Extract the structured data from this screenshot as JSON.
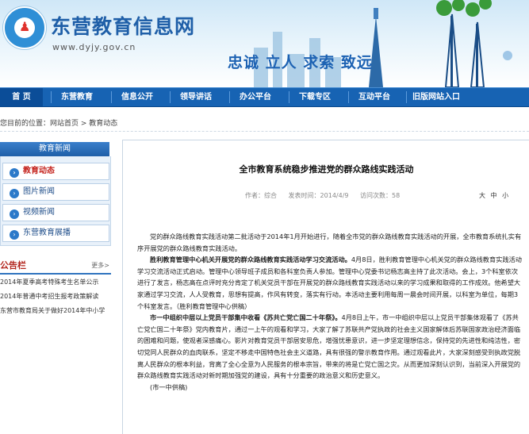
{
  "header": {
    "site_title": "东营教育信息网",
    "site_url": "www.dyjy.gov.cn",
    "slogan": "忠诚  立人  求索  致远",
    "logo_text": "DONGYING EDUCATION",
    "logo_top_text": "东营教育"
  },
  "nav": {
    "items": [
      "首 页",
      "东营教育",
      "信息公开",
      "领导讲话",
      "办公平台",
      "下载专区",
      "互动平台",
      "旧版网站入口"
    ]
  },
  "breadcrumb": "您目前的位置：网站首页  >  教育动态",
  "sidebar": {
    "title": "教育新闻",
    "items": [
      "教育动态",
      "图片新闻",
      "视频新闻",
      "东营教育展播"
    ]
  },
  "notice": {
    "title": "公告栏",
    "more": "更多>",
    "items": [
      "2014年夏季高考特殊考生名单公示",
      "2014年普通中考招生报考政策解读",
      "东营市教育局关于做好2014年中小学"
    ]
  },
  "article": {
    "title": "全市教育系统稳步推进党的群众路线实践活动",
    "meta_author": "作者：综合",
    "meta_date": "发表时间：2014/4/9",
    "meta_views": "访问次数：58",
    "size_big": "大",
    "size_mid": "中",
    "size_small": "小",
    "p1": "党的群众路线教育实践活动第二批活动于2014年1月开始进行，随着全市党的群众路线教育实践活动的开展，全市教育系统扎实有序开展党的群众路线教育实践活动。",
    "p2_lead": "胜利教育管理中心机关开展党的群众路线教育实践活动学习交流活动。",
    "p2": "4月8日，胜利教育管理中心机关党的群众路线教育实践活动学习交流活动正式启动。管理中心领导班子成员和各科室负责人参加。管理中心党委书记杨志高主持了此次活动。会上，3个科室依次进行了发言，杨志高在点评时充分肯定了机关党员干部在开展党的群众路线教育实践活动以来的学习成果和取得的工作成效。他希望大家通过学习交流，人人受教育，思想有提高，作风有转变，落实有行动。本活动主要利用每周一晨会时间开展，以科室为单位，每期3个科室发言。（胜利教育管理中心供稿）",
    "p3_lead": "市一中组织中层以上党员干部集中收看《苏共亡党亡国二十年祭》。",
    "p3": "4月8日上午，市一中组织中层以上党员干部集体观看了《苏共亡党亡国二十年祭》党内教育片，通过一上午的观看和学习，大家了解了苏联共产党执政的社会主义国家解体后苏联国家政治经济面临的困难和问题，使观者深感痛心。影片对教育党员干部居安思危，增强忧患意识，进一步坚定理想信念，保持党的先进性和纯洁性，密切党同人民群众的血肉联系，坚定不移走中国特色社会主义道路，具有很强的警示教育作用。通过观看此片，大家深刻感受到执政党脱离人民群众的根本利益，背离了全心全意为人民服务的根本宗旨，带来的将是亡党亡国之灾。从而更加深刻认识到，当前深入开展党的群众路线教育实践活动对新时期加强党的建设，具有十分重要的政治意义和历史意义。",
    "p3_src": "(市一中供稿)"
  }
}
